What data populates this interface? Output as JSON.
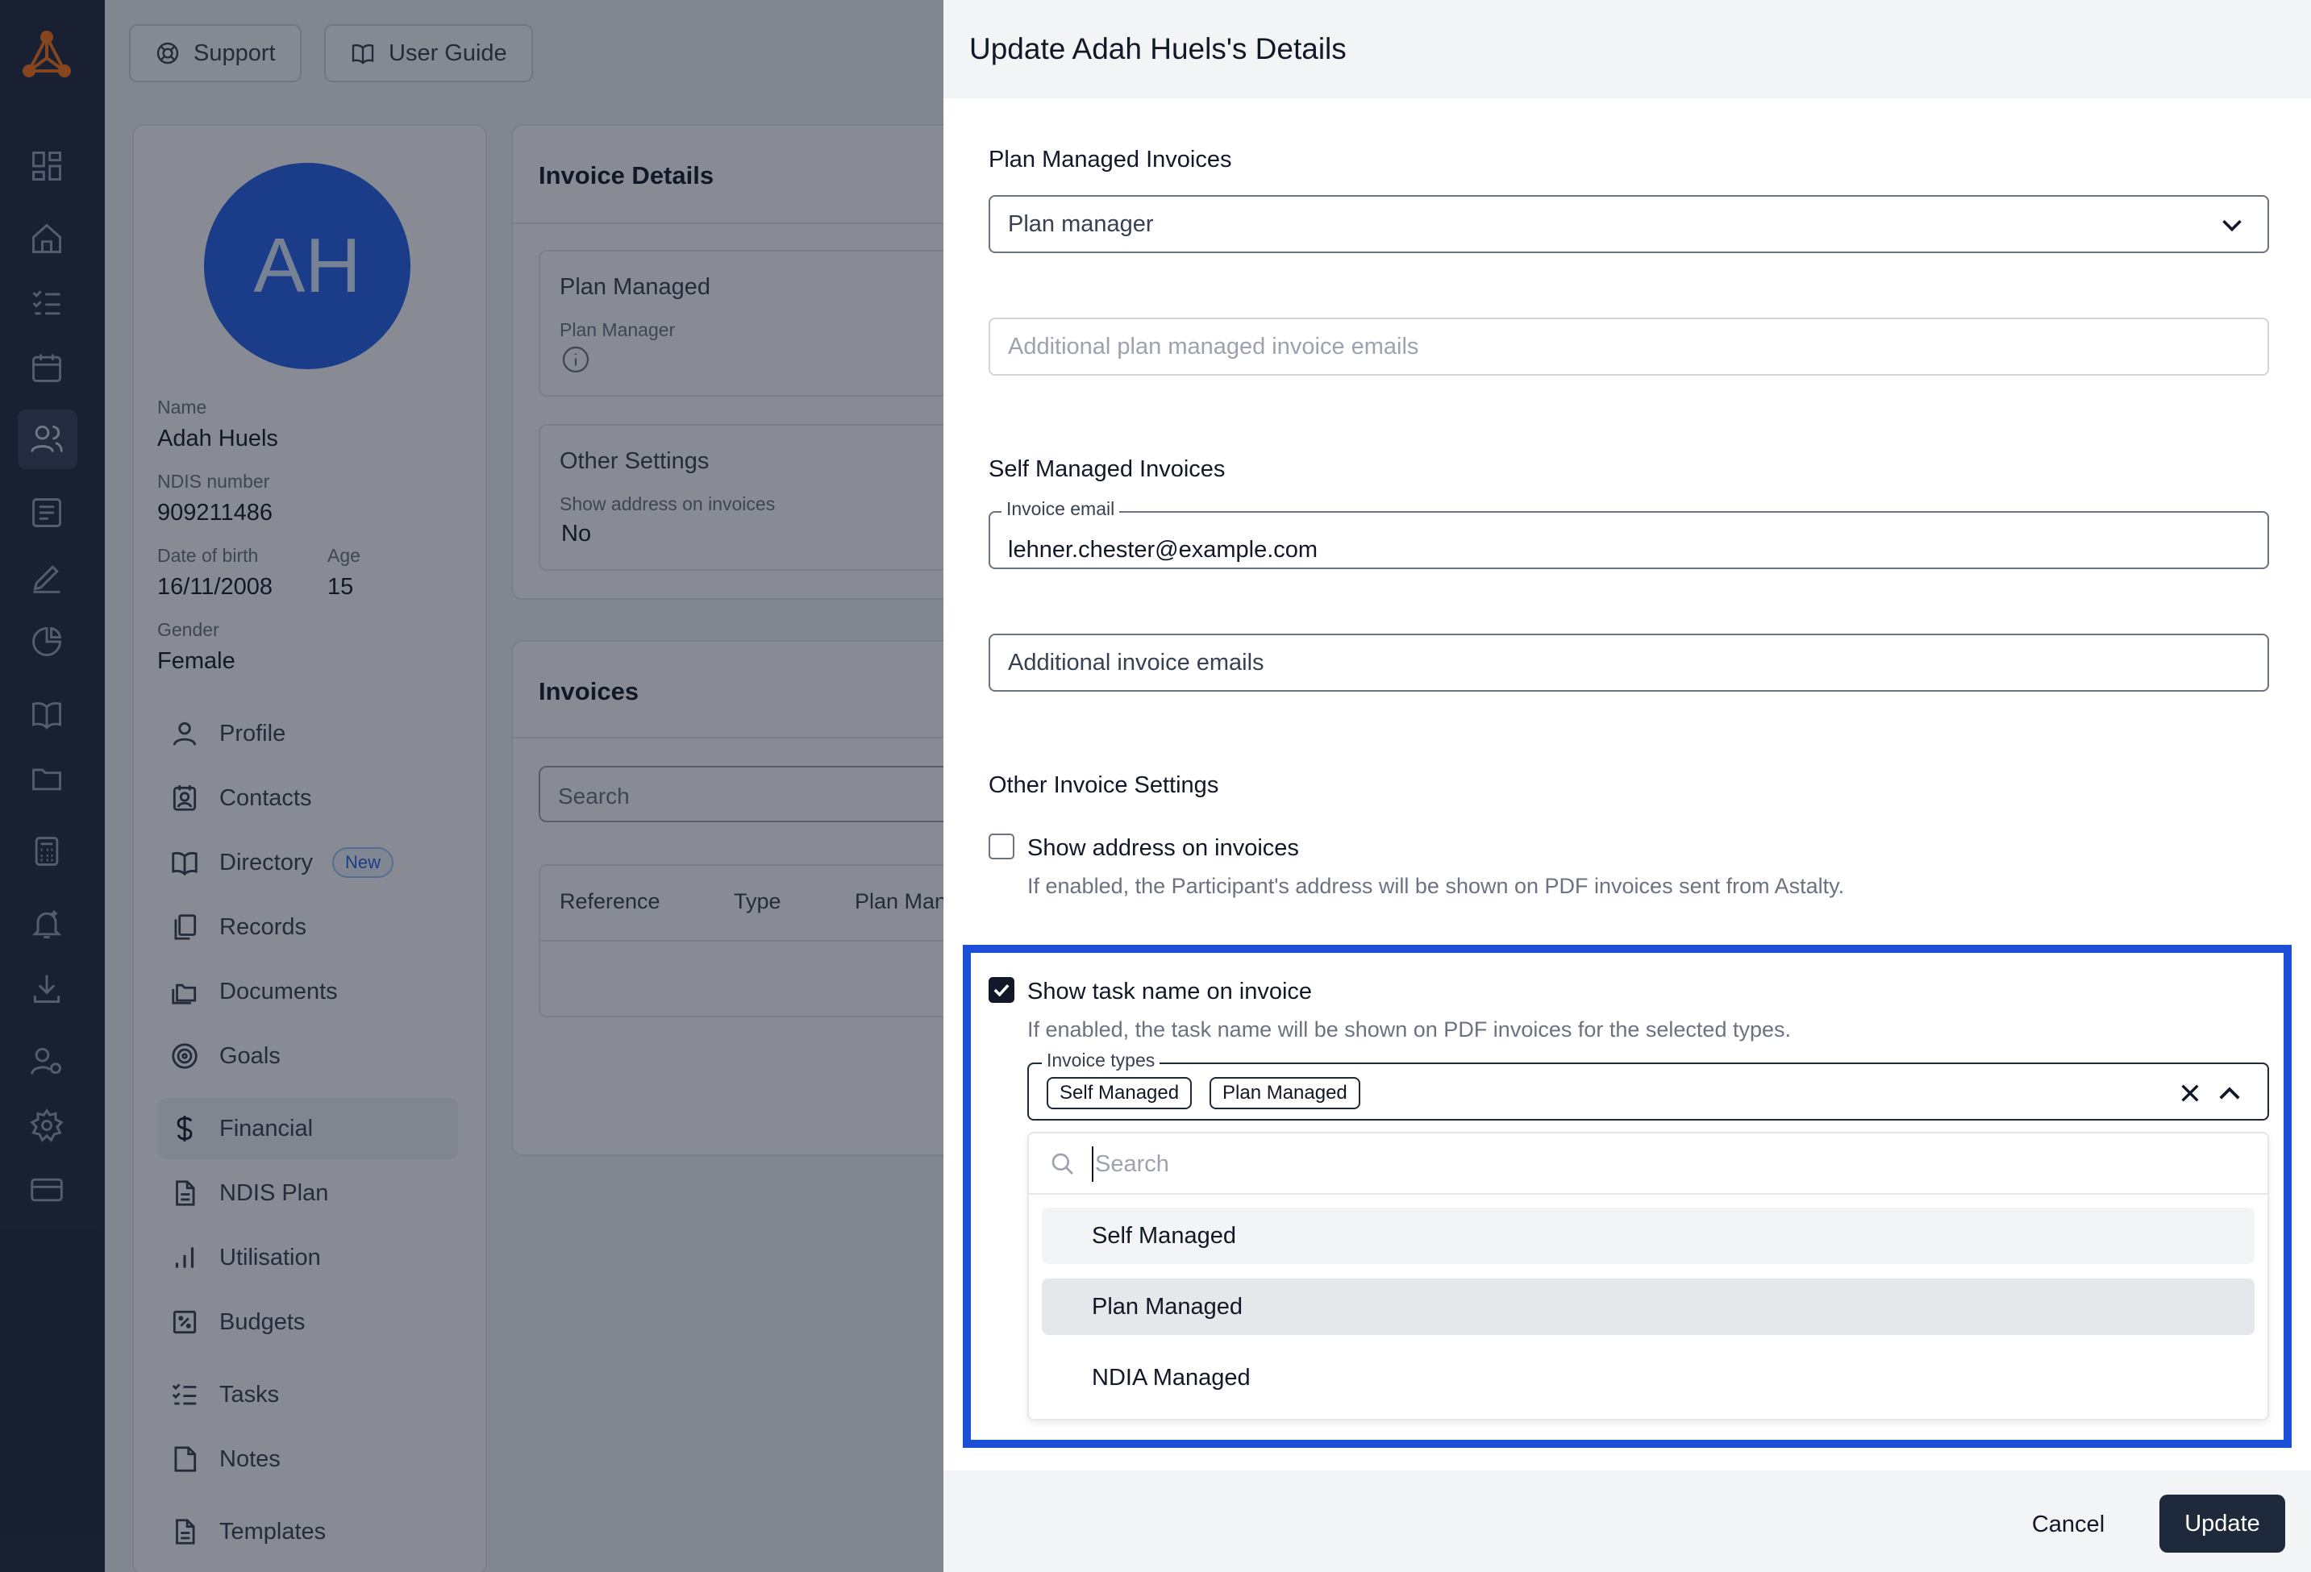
{
  "topbar": {
    "support": "Support",
    "user_guide": "User Guide"
  },
  "profile": {
    "initials": "AH",
    "name_label": "Name",
    "name": "Adah Huels",
    "ndis_label": "NDIS number",
    "ndis": "909211486",
    "dob_label": "Date of birth",
    "dob": "16/11/2008",
    "age_label": "Age",
    "age": "15",
    "gender_label": "Gender",
    "gender": "Female"
  },
  "menu": {
    "profile": "Profile",
    "contacts": "Contacts",
    "directory": "Directory",
    "directory_badge": "New",
    "records": "Records",
    "documents": "Documents",
    "goals": "Goals",
    "financial": "Financial",
    "ndis_plan": "NDIS Plan",
    "utilisation": "Utilisation",
    "budgets": "Budgets",
    "tasks": "Tasks",
    "notes": "Notes",
    "templates": "Templates"
  },
  "invoice_details": {
    "title": "Invoice Details",
    "plan_managed": "Plan Managed",
    "plan_manager": "Plan Manager",
    "other_settings": "Other Settings",
    "show_address_label": "Show address on invoices",
    "show_address_value": "No"
  },
  "invoices": {
    "title": "Invoices",
    "search_placeholder": "Search",
    "columns": [
      "Reference",
      "Type",
      "Plan Man"
    ]
  },
  "drawer": {
    "title": "Update Adah Huels's Details",
    "plan_managed_section": "Plan Managed Invoices",
    "plan_manager_select": "Plan manager",
    "additional_plan_emails_placeholder": "Additional plan managed invoice emails",
    "self_managed_section": "Self Managed Invoices",
    "invoice_email_label": "Invoice email",
    "invoice_email_value": "lehner.chester@example.com",
    "additional_invoice_emails": "Additional invoice emails",
    "other_section": "Other Invoice Settings",
    "show_address_label": "Show address on invoices",
    "show_address_help": "If enabled, the Participant's address will be shown on PDF invoices sent from Astalty.",
    "show_task_label": "Show task name on invoice",
    "show_task_help": "If enabled, the task name will be shown on PDF invoices for the selected types.",
    "invoice_types_label": "Invoice types",
    "selected_types": [
      "Self Managed",
      "Plan Managed"
    ],
    "dropdown_search_placeholder": "Search",
    "options": [
      "Self Managed",
      "Plan Managed",
      "NDIA Managed"
    ],
    "cancel": "Cancel",
    "update": "Update"
  },
  "colors": {
    "rail": "#1e293b",
    "highlight": "#1d4ed8",
    "primary_button": "#1e293b",
    "avatar": "#2563eb"
  }
}
